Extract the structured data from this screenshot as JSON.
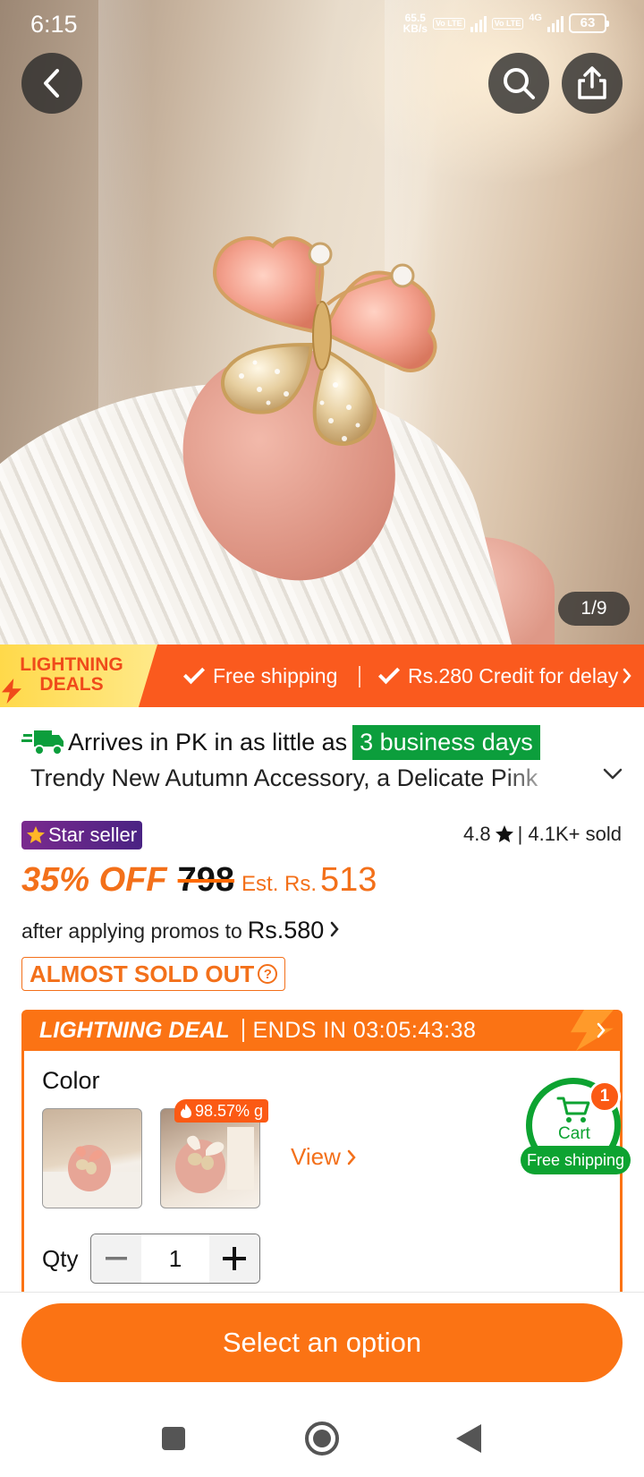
{
  "status_bar": {
    "time": "6:15",
    "speed_value": "65.5",
    "speed_unit": "KB/s",
    "volte": "Vo LTE",
    "network": "4G",
    "battery": "63"
  },
  "gallery": {
    "counter": "1/9"
  },
  "banner": {
    "deal_line1": "LIGHTNING",
    "deal_line2": "DEALS",
    "free_shipping": "Free shipping",
    "credit": "Rs.280 Credit for delay"
  },
  "product": {
    "arrives_prefix": "Arrives in PK in as little as",
    "arrives_days": "3 business days",
    "title": "Trendy New Autumn Accessory, a Delicate Pink",
    "star_seller": "Star seller",
    "rating": "4.8",
    "sold": "| 4.1K+ sold",
    "discount": "35% OFF",
    "original_price": "798",
    "est_label": "Est. Rs.",
    "est_price": "513",
    "promo_text": "after applying promos to",
    "promo_price": "Rs.580",
    "stock_status": "ALMOST SOLD OUT"
  },
  "deal": {
    "title": "LIGHTNING DEAL",
    "ends_label": "ENDS IN",
    "countdown": "03:05:43:38"
  },
  "options": {
    "color_label": "Color",
    "hot_percent": "98.57% g",
    "view_label": "View",
    "qty_label": "Qty",
    "qty_value": "1"
  },
  "cart": {
    "label": "Cart",
    "count": "1",
    "free_shipping": "Free shipping"
  },
  "cta": {
    "label": "Select an option"
  },
  "colors": {
    "accent_orange": "#fb7314",
    "banner_orange": "#fa5a1e",
    "delivery_green": "#0c9e3c",
    "cart_green": "#0da331",
    "star_seller_purple": "#5a2587"
  }
}
